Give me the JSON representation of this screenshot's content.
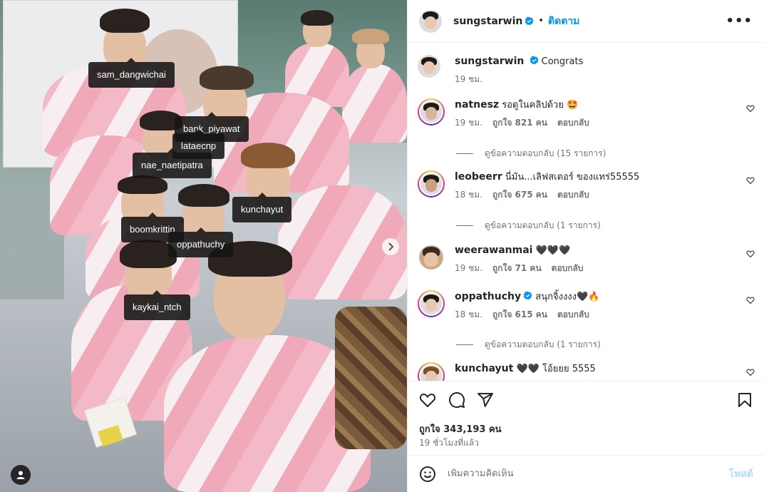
{
  "photo": {
    "tags": [
      {
        "id": "sam",
        "label": "sam_dangwichai"
      },
      {
        "id": "bank",
        "label": "bank_piyawat"
      },
      {
        "id": "latae",
        "label": "lataecnp"
      },
      {
        "id": "nae",
        "label": "nae_naetipatra"
      },
      {
        "id": "kunchayut",
        "label": "kunchayut"
      },
      {
        "id": "boom",
        "label": "boomkrittin"
      },
      {
        "id": "oppa",
        "label": "oppathuchy"
      },
      {
        "id": "kaykai",
        "label": "kaykai_ntch"
      }
    ],
    "next_icon": "chevron-right-icon",
    "tagged_users_icon": "user-icon"
  },
  "header": {
    "username": "sungstarwin",
    "separator": "•",
    "follow_label": "ติดตาม",
    "more_icon": "more-horizontal-icon",
    "more_label": "•••"
  },
  "caption": {
    "username": "sungstarwin",
    "text": "Congrats",
    "time": "19 ชม."
  },
  "comments": [
    {
      "username": "natnesz",
      "text": "รอดูในคลิปด้วย 🤩",
      "time": "19 ชม.",
      "likes": "ถูกใจ 821 คน",
      "reply": "ตอบกลับ",
      "view_replies": "ดูข้อความตอบกลับ (15 รายการ)",
      "verified": false,
      "story_ring": true
    },
    {
      "username": "leobeerr",
      "text": "นี่มัน...เลิฟสเตอร์ ของแทร่55555",
      "time": "18 ชม.",
      "likes": "ถูกใจ 675 คน",
      "reply": "ตอบกลับ",
      "view_replies": "ดูข้อความตอบกลับ (1 รายการ)",
      "verified": false,
      "story_ring": true
    },
    {
      "username": "weerawanmai",
      "text": "🖤🖤🖤",
      "time": "19 ชม.",
      "likes": "ถูกใจ 71 คน",
      "reply": "ตอบกลับ",
      "view_replies": "",
      "verified": false,
      "story_ring": false
    },
    {
      "username": "oppathuchy",
      "text": "สนุกจิ้งงงง🖤🔥",
      "time": "18 ชม.",
      "likes": "ถูกใจ 615 คน",
      "reply": "ตอบกลับ",
      "view_replies": "ดูข้อความตอบกลับ (1 รายการ)",
      "verified": true,
      "story_ring": true
    },
    {
      "username": "kunchayut",
      "text": "🖤🖤 โอ้ยยย 5555",
      "time": "",
      "likes": "",
      "reply": "",
      "view_replies": "",
      "verified": false,
      "story_ring": true
    }
  ],
  "actions": {
    "like_icon": "heart-icon",
    "comment_icon": "comment-icon",
    "share_icon": "send-icon",
    "save_icon": "bookmark-icon",
    "likes_text": "ถูกใจ 343,193 คน",
    "time_ago": "19 ชั่วโมงที่แล้ว"
  },
  "add_comment": {
    "emoji_icon": "emoji-icon",
    "placeholder": "เพิ่มความคิดเห็น",
    "post_label": "โพสต์"
  },
  "colors": {
    "link_blue": "#0095f6",
    "verified_blue": "#0095f6",
    "muted_text": "#737373",
    "post_disabled": "#b2dffc"
  }
}
